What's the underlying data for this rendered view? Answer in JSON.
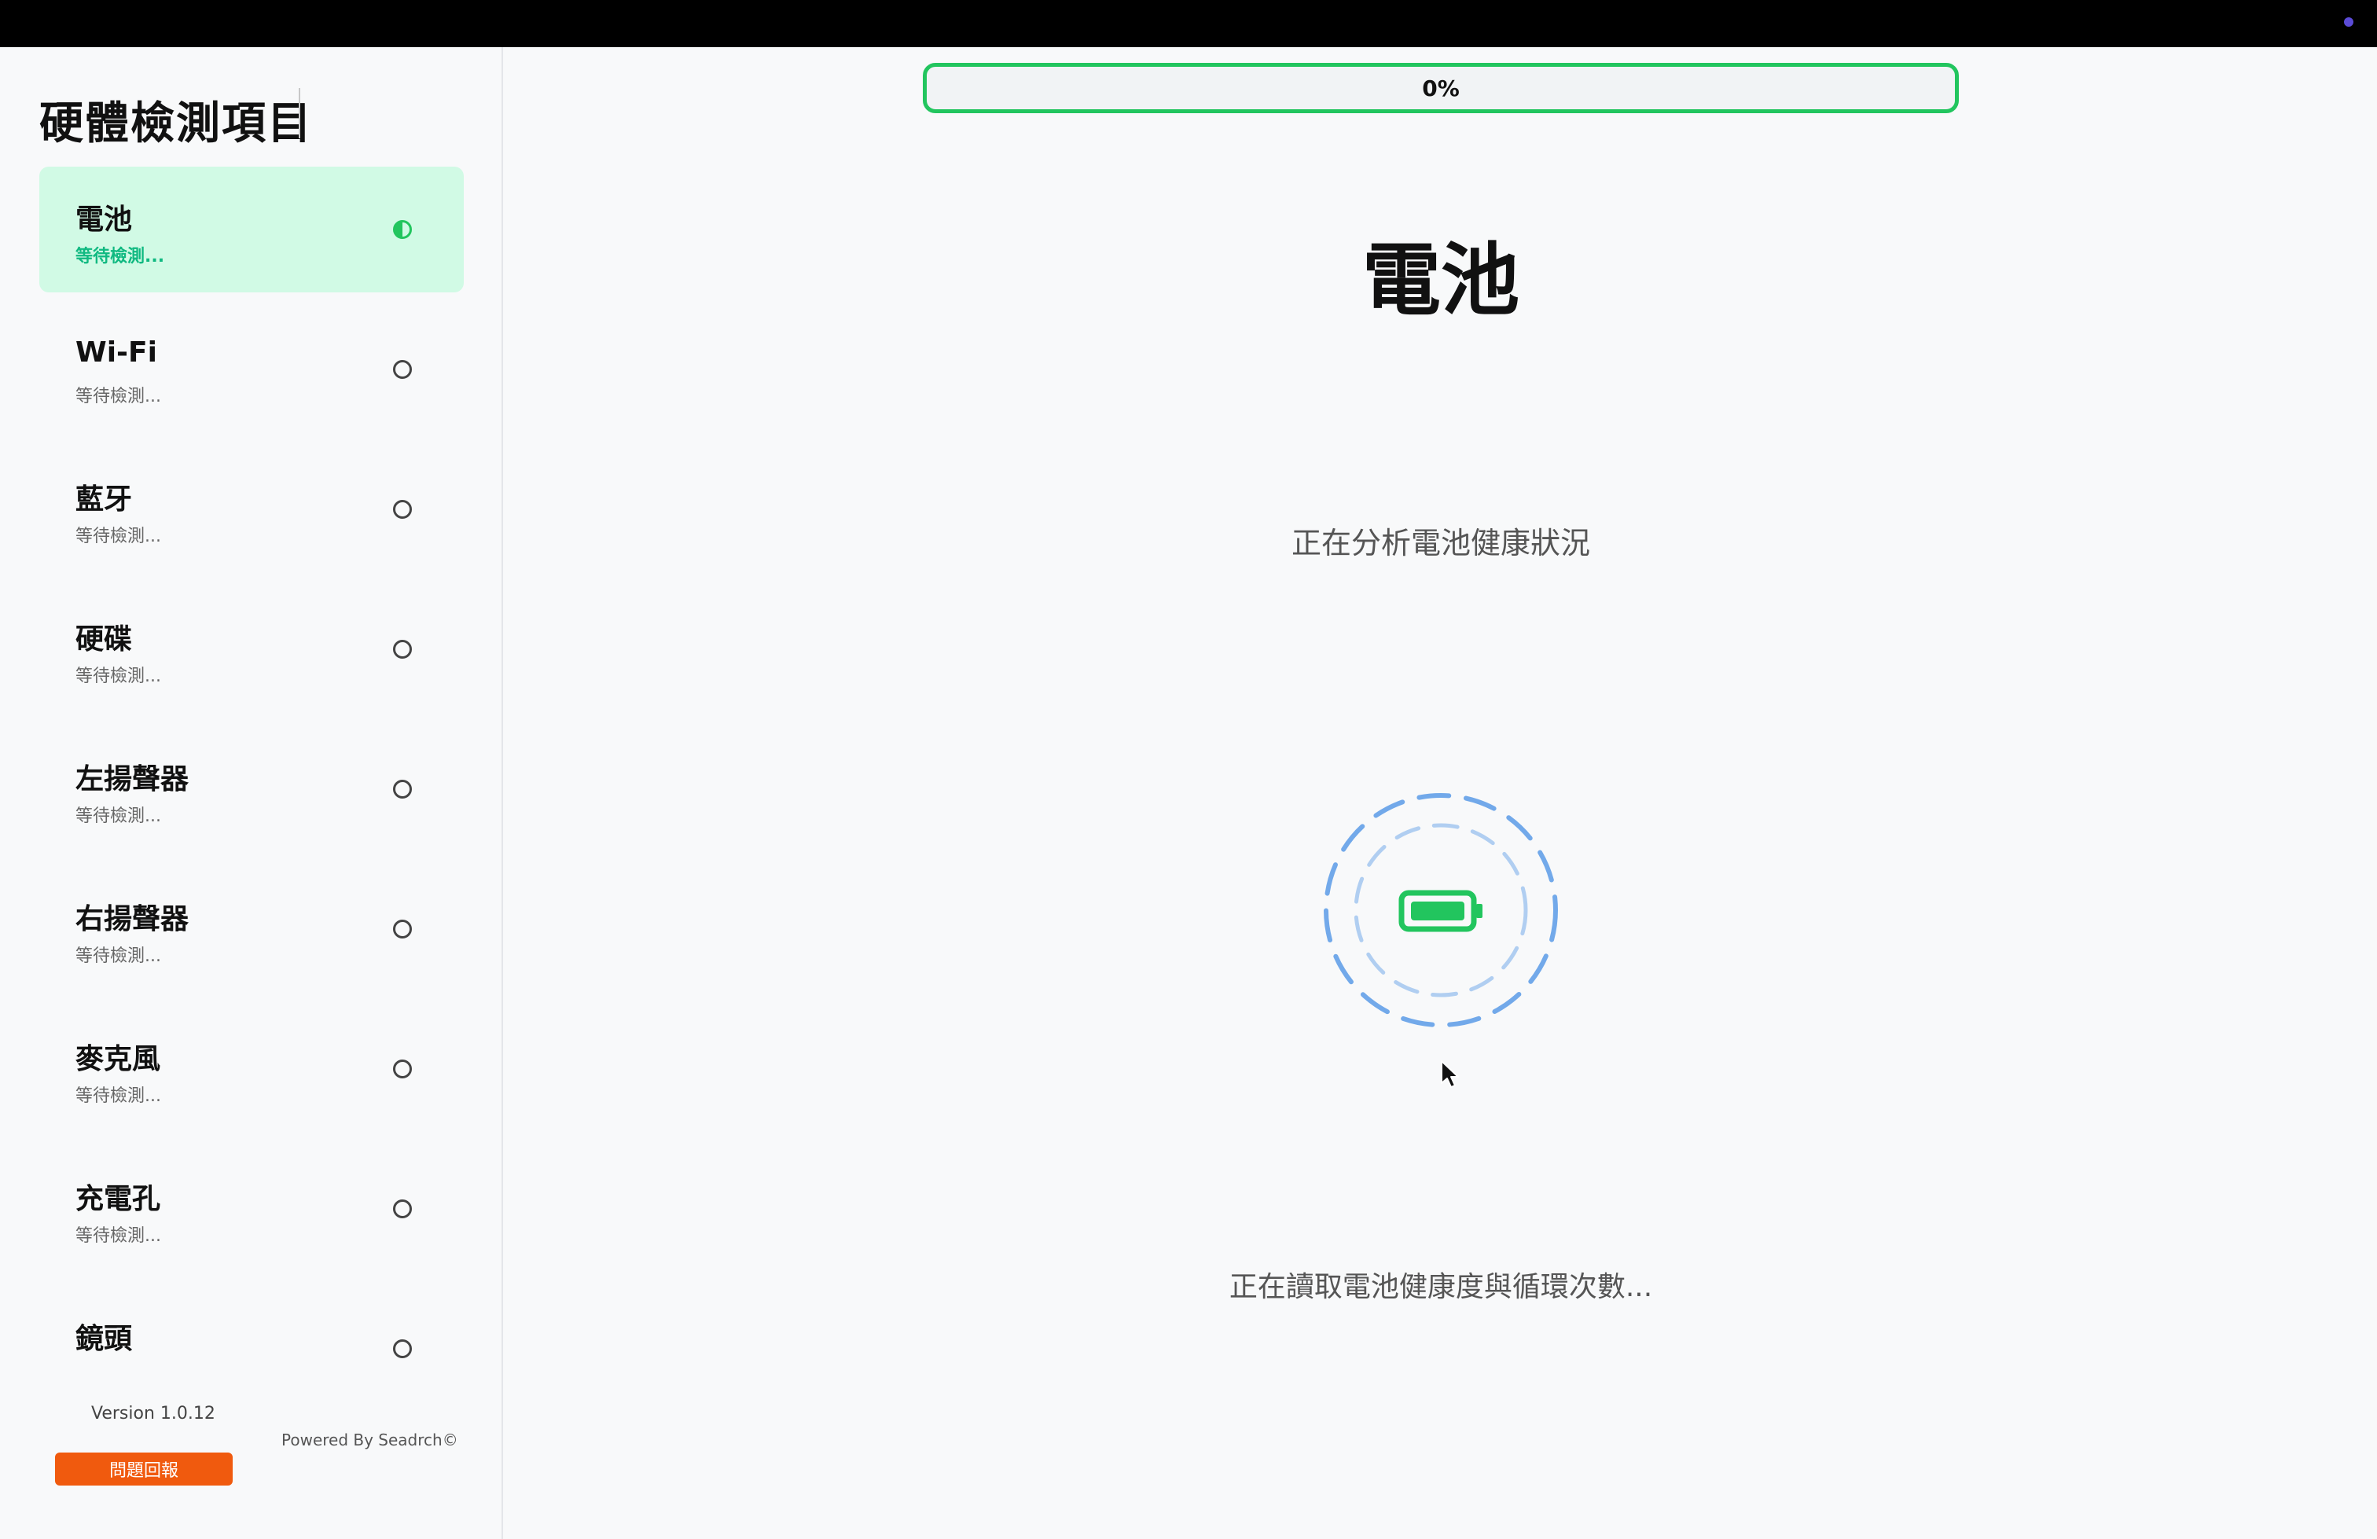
{
  "sidebar": {
    "title": "硬體檢測項目",
    "items": [
      {
        "label": "電池",
        "status": "等待檢測...",
        "active": true
      },
      {
        "label": "Wi-Fi",
        "status": "等待檢測...",
        "active": false
      },
      {
        "label": "藍牙",
        "status": "等待檢測...",
        "active": false
      },
      {
        "label": "硬碟",
        "status": "等待檢測...",
        "active": false
      },
      {
        "label": "左揚聲器",
        "status": "等待檢測...",
        "active": false
      },
      {
        "label": "右揚聲器",
        "status": "等待檢測...",
        "active": false
      },
      {
        "label": "麥克風",
        "status": "等待檢測...",
        "active": false
      },
      {
        "label": "充電孔",
        "status": "等待檢測...",
        "active": false
      },
      {
        "label": "鏡頭",
        "status": "",
        "active": false
      }
    ],
    "version": "Version 1.0.12",
    "powered_by": "Powered By Seadrch©",
    "report_button": "問題回報"
  },
  "main": {
    "progress": {
      "value": 0,
      "label": "0%"
    },
    "title": "電池",
    "subtitle": "正在分析電池健康狀況",
    "status": "正在讀取電池健康度與循環次數...",
    "icon": "battery-icon"
  },
  "colors": {
    "accent_green": "#22c55e",
    "active_bg": "#d1fae5",
    "loader_blue": "#5b9be6",
    "report_orange": "#f05a0e"
  }
}
